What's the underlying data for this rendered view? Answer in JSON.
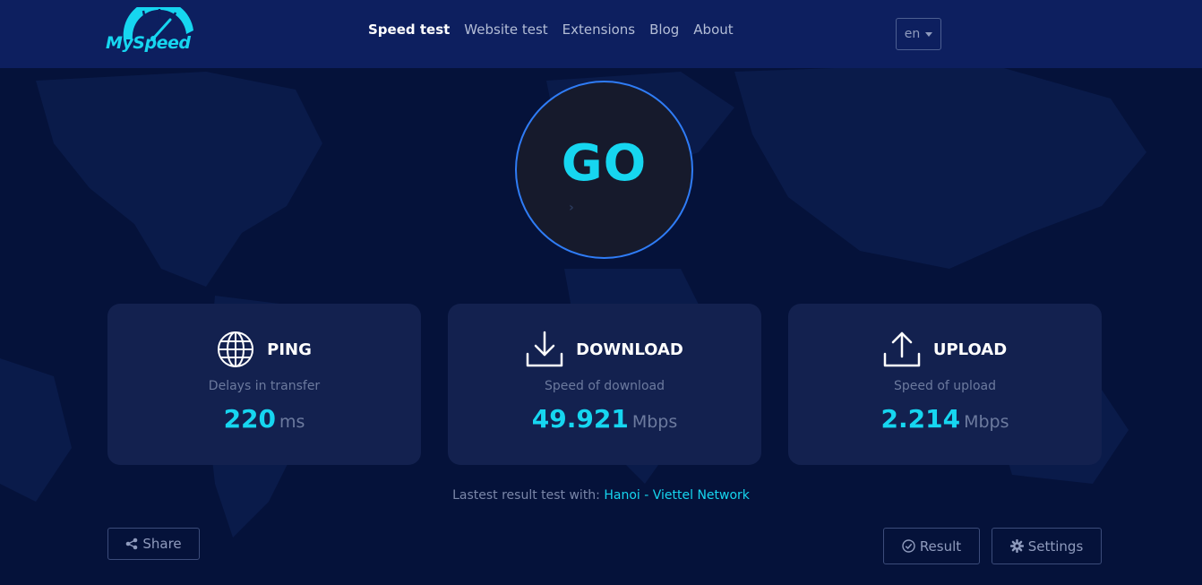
{
  "logo": {
    "text": "MySpeed"
  },
  "nav": [
    {
      "label": "Speed test",
      "active": true
    },
    {
      "label": "Website test"
    },
    {
      "label": "Extensions"
    },
    {
      "label": "Blog"
    },
    {
      "label": "About"
    }
  ],
  "language": {
    "value": "en"
  },
  "go_button": {
    "label": "GO"
  },
  "cards": {
    "ping": {
      "title": "PING",
      "subtitle": "Delays in transfer",
      "value": "220",
      "unit": "ms",
      "icon": "globe-icon"
    },
    "download": {
      "title": "DOWNLOAD",
      "subtitle": "Speed of download",
      "value": "49.921",
      "unit": "Mbps",
      "icon": "download-icon"
    },
    "upload": {
      "title": "UPLOAD",
      "subtitle": "Speed of upload",
      "value": "2.214",
      "unit": "Mbps",
      "icon": "upload-icon"
    }
  },
  "latest": {
    "prefix": "Lastest result test with:",
    "server": "Hanoi - Viettel Network"
  },
  "buttons": {
    "share": "Share",
    "result": "Result",
    "settings": "Settings"
  },
  "colors": {
    "accent": "#16d6f0",
    "ring": "#2f7cf6",
    "header_bg": "#0d1f5f",
    "page_bg": "#05123a",
    "card_bg": "#13214f"
  }
}
